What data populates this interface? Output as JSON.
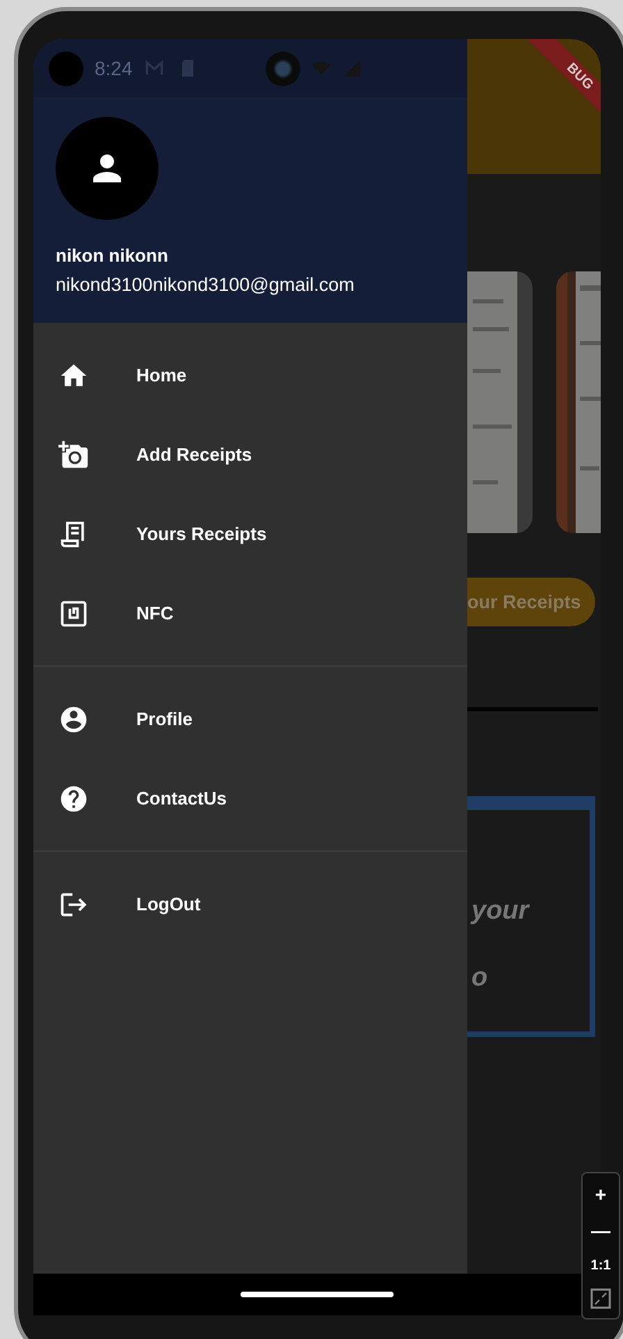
{
  "status_bar": {
    "time": "8:24"
  },
  "debug_banner": {
    "label": "BUG"
  },
  "drawer": {
    "user_name": "nikon nikonn",
    "email": "nikond3100nikond3100@gmail.com",
    "sections": [
      [
        {
          "label": "Home",
          "kind": "home"
        },
        {
          "label": "Add Receipts",
          "kind": "add_photo"
        },
        {
          "label": "Yours Receipts",
          "kind": "receipt"
        },
        {
          "label": "NFC",
          "kind": "nfc"
        }
      ],
      [
        {
          "label": "Profile",
          "kind": "account"
        },
        {
          "label": "ContactUs",
          "kind": "help"
        }
      ],
      [
        {
          "label": "LogOut",
          "kind": "logout"
        }
      ]
    ]
  },
  "background": {
    "button": "our Receipts",
    "box_lines": [
      "your",
      "o"
    ]
  },
  "zoom_controls": [
    "+",
    "—",
    "1:1"
  ]
}
